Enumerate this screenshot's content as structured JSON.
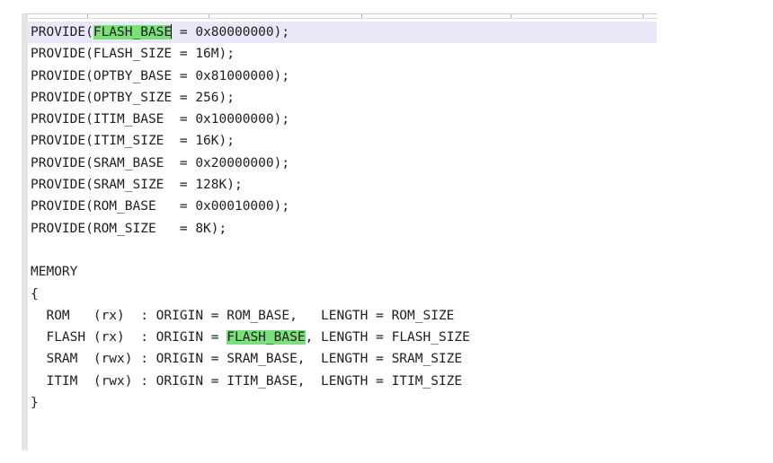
{
  "editor": {
    "highlight_color": "#7be07b",
    "current_line_color": "#e8e8f8",
    "lines": [
      {
        "a": "PROVIDE(",
        "hl": "FLASH_BASE",
        "b": " = 0x80000000);"
      },
      {
        "text": "PROVIDE(FLASH_SIZE = 16M);"
      },
      {
        "text": "PROVIDE(OPTBY_BASE = 0x81000000);"
      },
      {
        "text": "PROVIDE(OPTBY_SIZE = 256);"
      },
      {
        "text": "PROVIDE(ITIM_BASE  = 0x10000000);"
      },
      {
        "text": "PROVIDE(ITIM_SIZE  = 16K);"
      },
      {
        "text": "PROVIDE(SRAM_BASE  = 0x20000000);"
      },
      {
        "text": "PROVIDE(SRAM_SIZE  = 128K);"
      },
      {
        "text": "PROVIDE(ROM_BASE   = 0x00010000);"
      },
      {
        "text": "PROVIDE(ROM_SIZE   = 8K);"
      },
      {
        "text": ""
      },
      {
        "text": "MEMORY"
      },
      {
        "text": "{"
      },
      {
        "text": "  ROM   (rx)  : ORIGIN = ROM_BASE,   LENGTH = ROM_SIZE"
      },
      {
        "a": "  FLASH (rx)  : ORIGIN = ",
        "hl": "FLASH_BASE",
        "b": ", LENGTH = FLASH_SIZE"
      },
      {
        "text": "  SRAM  (rwx) : ORIGIN = SRAM_BASE,  LENGTH = SRAM_SIZE"
      },
      {
        "text": "  ITIM  (rwx) : ORIGIN = ITIM_BASE,  LENGTH = ITIM_SIZE"
      },
      {
        "text": "}"
      }
    ]
  }
}
